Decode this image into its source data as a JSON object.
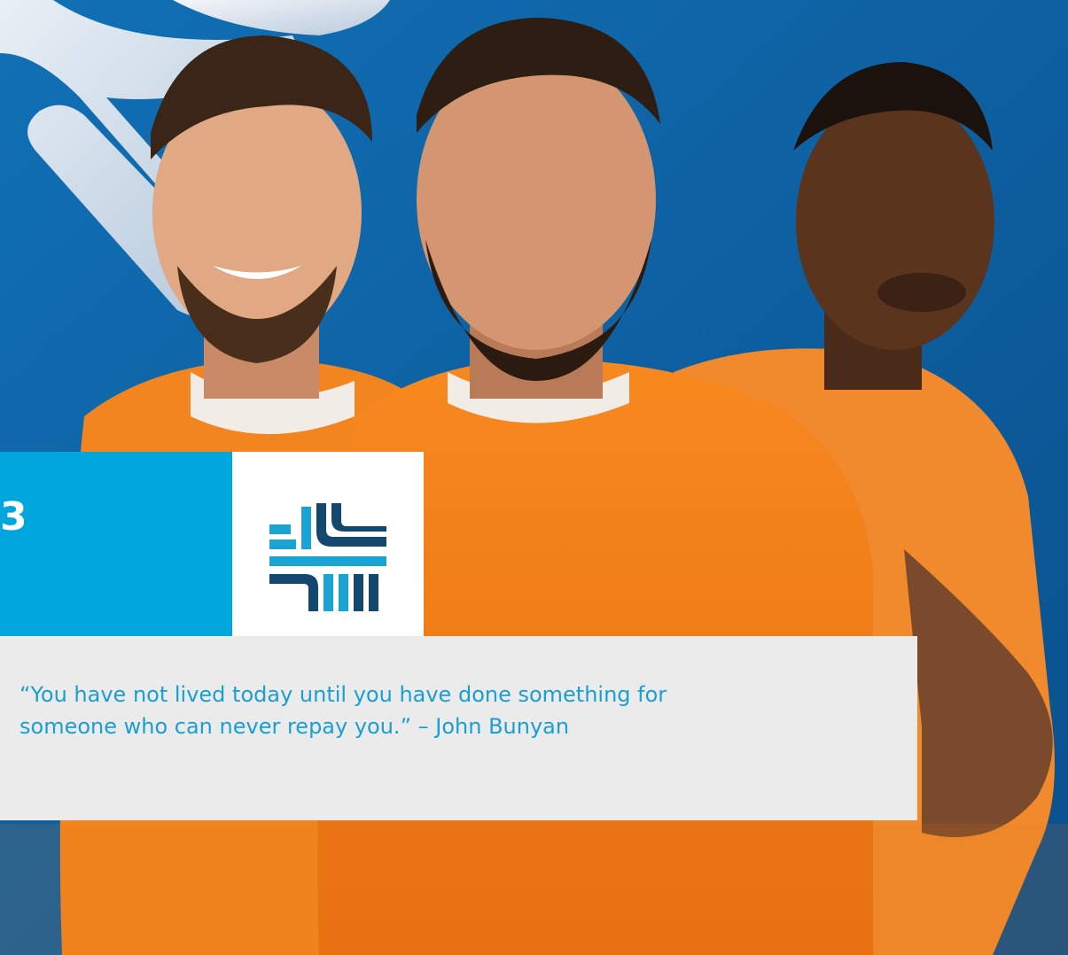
{
  "panel": {
    "number": "3"
  },
  "quote": {
    "text": "“You have not lived today until you have done something for\n someone who can never repay you.” – John Bunyan"
  },
  "logo": {
    "icon": "cross-emblem-icon"
  },
  "colors": {
    "background_blue": "#0c5a9c",
    "panel_cyan": "#00a6dc",
    "logo_navy": "#14476d",
    "logo_cyan": "#1aa4d4",
    "quote_text": "#1a9fd3",
    "quote_bg": "#ebebeb",
    "shirt_orange": "#f3801b"
  }
}
